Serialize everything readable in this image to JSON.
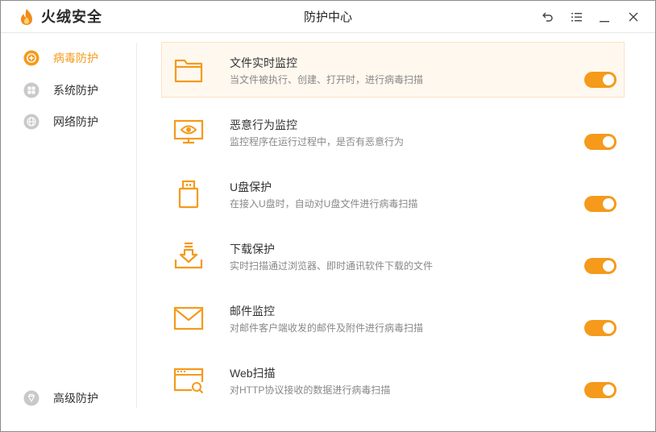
{
  "app": {
    "brand": "火绒安全",
    "title": "防护中心",
    "accent_color": "#f59a1b"
  },
  "window_controls": [
    {
      "name": "back-icon"
    },
    {
      "name": "menu-icon"
    },
    {
      "name": "minimize-icon"
    },
    {
      "name": "close-icon"
    }
  ],
  "sidebar": {
    "items": [
      {
        "label": "病毒防护",
        "icon": "virus-shield-icon",
        "active": true
      },
      {
        "label": "系统防护",
        "icon": "windows-icon",
        "active": false
      },
      {
        "label": "网络防护",
        "icon": "globe-icon",
        "active": false
      }
    ],
    "bottom_item": {
      "label": "高级防护",
      "icon": "diamond-icon"
    }
  },
  "features": [
    {
      "title": "文件实时监控",
      "desc": "当文件被执行、创建、打开时，进行病毒扫描",
      "icon": "folder-icon",
      "enabled": true
    },
    {
      "title": "恶意行为监控",
      "desc": "监控程序在运行过程中，是否有恶意行为",
      "icon": "monitor-eye-icon",
      "enabled": true
    },
    {
      "title": "U盘保护",
      "desc": "在接入U盘时，自动对U盘文件进行病毒扫描",
      "icon": "usb-drive-icon",
      "enabled": true
    },
    {
      "title": "下载保护",
      "desc": "实时扫描通过浏览器、即时通讯软件下载的文件",
      "icon": "download-tray-icon",
      "enabled": true
    },
    {
      "title": "邮件监控",
      "desc": "对邮件客户端收发的邮件及附件进行病毒扫描",
      "icon": "envelope-icon",
      "enabled": true
    },
    {
      "title": "Web扫描",
      "desc": "对HTTP协议接收的数据进行病毒扫描",
      "icon": "web-scan-icon",
      "enabled": true
    }
  ]
}
